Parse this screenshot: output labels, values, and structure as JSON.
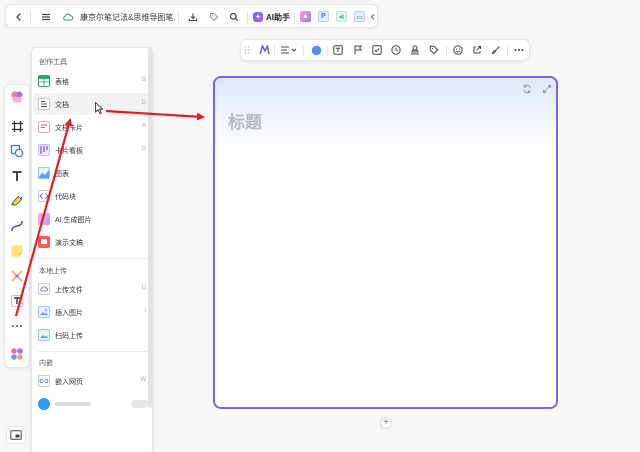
{
  "topbar": {
    "doc_title": "康京尔笔记法&思维导图笔...",
    "ai_label": "AI助手",
    "icons": [
      "back-icon",
      "menu-icon",
      "cloud-sync-icon",
      "import-icon",
      "tag-icon",
      "search-icon",
      "ai-assistant-icon",
      "image-app-icon",
      "p-app-icon",
      "share-app-icon",
      "chat-app-icon",
      "collapse-icon"
    ]
  },
  "floatbar": {
    "icons": [
      "drag-handle-icon",
      "ai-icon",
      "align-icon",
      "color-circle-icon",
      "text-box-icon",
      "flag-icon",
      "checkbox-icon",
      "clock-icon",
      "stamp-icon",
      "tag-icon",
      "emoji-icon",
      "link-icon",
      "brush-icon",
      "more-icon"
    ],
    "accent_color": "#4e8ff0"
  },
  "panel": {
    "section_create": "创作工具",
    "section_upload": "本地上传",
    "section_embed": "内嵌",
    "create_items": [
      {
        "label": "表格",
        "key": "B"
      },
      {
        "label": "文档",
        "key": "D"
      },
      {
        "label": "文档卡片",
        "key": "A"
      },
      {
        "label": "卡片看板",
        "key": "G"
      },
      {
        "label": "图表",
        "key": ""
      },
      {
        "label": "代码块",
        "key": ""
      },
      {
        "label": "AI 生成图片",
        "key": ""
      },
      {
        "label": "演示文稿",
        "key": ""
      }
    ],
    "upload_items": [
      {
        "label": "上传文件",
        "key": "U"
      },
      {
        "label": "插入图片",
        "key": "I"
      },
      {
        "label": "扫码上传",
        "key": ""
      }
    ],
    "embed_items": [
      {
        "label": "嵌入网页",
        "key": "W"
      }
    ]
  },
  "leftbar": {
    "icons": [
      "template-icon",
      "frame-icon",
      "shape-icon",
      "text-icon",
      "pen-icon",
      "connector-icon",
      "sticky-note-icon",
      "mindmap-icon",
      "text-card-icon",
      "more-icon",
      "apps-icon"
    ]
  },
  "card": {
    "title": "标题",
    "border_color": "#7a63e6"
  },
  "annotation_color": "#e02020"
}
